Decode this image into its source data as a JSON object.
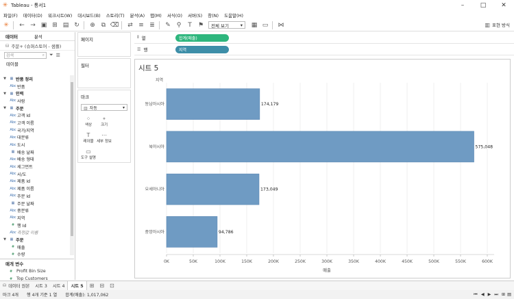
{
  "window": {
    "title": "Tableau - 통서1",
    "minimize": "–",
    "maximize": "□",
    "close": "✕"
  },
  "menu": [
    "파일(F)",
    "데이터(D)",
    "워크시트(W)",
    "대시보드(B)",
    "스토리(T)",
    "분석(A)",
    "맵(M)",
    "서식(O)",
    "서버(S)",
    "창(N)",
    "도움말(H)"
  ],
  "toolbar": {
    "view_select": "전체 보기",
    "present_label": "표현 방식"
  },
  "left_panel": {
    "tab_data": "데이터",
    "tab_analytics": "분석",
    "source": "주문+ (슈퍼스토어 - 샘플)",
    "search_placeholder": "검색",
    "tables_label": "테이블",
    "tree": [
      {
        "kind": "folder",
        "label": "반품 정리"
      },
      {
        "kind": "field",
        "type": "Abc",
        "label": "반품"
      },
      {
        "kind": "folder",
        "label": "인력"
      },
      {
        "kind": "field",
        "type": "Abc",
        "label": "사람"
      },
      {
        "kind": "folder",
        "label": "주문"
      },
      {
        "kind": "field",
        "type": "Abc",
        "label": "고객 Id"
      },
      {
        "kind": "field",
        "type": "Abc",
        "label": "고객 이름"
      },
      {
        "kind": "field",
        "type": "Abc",
        "label": "국가/지역"
      },
      {
        "kind": "field",
        "type": "Abc",
        "label": "대분류"
      },
      {
        "kind": "field",
        "type": "Abc",
        "label": "도시"
      },
      {
        "kind": "field",
        "type": "▦",
        "label": "배송 날짜"
      },
      {
        "kind": "field",
        "type": "Abc",
        "label": "배송 형태"
      },
      {
        "kind": "field",
        "type": "Abc",
        "label": "세그먼트"
      },
      {
        "kind": "field",
        "type": "Abc",
        "label": "시/도"
      },
      {
        "kind": "field",
        "type": "Abc",
        "label": "제품 Id"
      },
      {
        "kind": "field",
        "type": "Abc",
        "label": "제품 이름"
      },
      {
        "kind": "field",
        "type": "Abc",
        "label": "주문 Id"
      },
      {
        "kind": "field",
        "type": "▦",
        "label": "주문 날짜"
      },
      {
        "kind": "field",
        "type": "Abc",
        "label": "중분류"
      },
      {
        "kind": "field",
        "type": "Abc",
        "label": "지역"
      },
      {
        "kind": "field",
        "type": "#",
        "label": "행 Id"
      },
      {
        "kind": "italic",
        "type": "Abc",
        "label": "측정값 이름"
      },
      {
        "kind": "folder",
        "label": "주문"
      },
      {
        "kind": "field",
        "type": "#",
        "label": "매출"
      },
      {
        "kind": "field",
        "type": "#",
        "label": "수량"
      }
    ],
    "params_label": "매개 변수",
    "params": [
      "Profit Bin Size",
      "Top Customers"
    ]
  },
  "cards": {
    "pages": "페이지",
    "filters": "필터",
    "marks": "마크",
    "marks_type": "자동"
  },
  "marks_buttons": [
    "색상",
    "크기",
    "레이블",
    "세부 정보",
    "도구 설명"
  ],
  "shelves": {
    "columns_label": "열",
    "columns_pill": "합계(매출)",
    "rows_label": "행",
    "rows_pill": "지역"
  },
  "sheet": {
    "title": "시트 5"
  },
  "chart_data": {
    "type": "bar",
    "orientation": "horizontal",
    "row_header": "지역",
    "categories": [
      "동남아시아",
      "북아시아",
      "오세아니아",
      "중앙아시아"
    ],
    "values": [
      174179,
      575048,
      173049,
      94786
    ],
    "value_labels": [
      "174,179",
      "575,048",
      "173,049",
      "94,786"
    ],
    "xlabel": "매출",
    "xlim": [
      0,
      600000
    ],
    "xticks": [
      0,
      50000,
      100000,
      150000,
      200000,
      250000,
      300000,
      350000,
      400000,
      450000,
      500000,
      550000,
      600000
    ],
    "xtick_labels": [
      "0K",
      "50K",
      "100K",
      "150K",
      "200K",
      "250K",
      "300K",
      "350K",
      "400K",
      "450K",
      "500K",
      "550K",
      "600K"
    ],
    "bar_color": "#6f9bc3",
    "grid": true
  },
  "tabs": {
    "data_source": "데이터 원본",
    "sheets": [
      "시트 3",
      "시트 4",
      "시트 5"
    ],
    "active": "시트 5"
  },
  "status": {
    "marks": "마크 4개",
    "rows": "행 4개 기준 1 열",
    "sum": "합계(매출): 1,017,062"
  }
}
